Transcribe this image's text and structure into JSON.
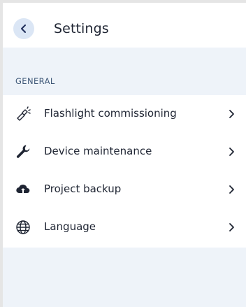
{
  "header": {
    "title": "Settings"
  },
  "general_section": {
    "label": "GENERAL",
    "items": [
      {
        "label": "Flashlight commissioning",
        "icon": "flashlight-icon"
      },
      {
        "label": "Device maintenance",
        "icon": "wrench-icon"
      },
      {
        "label": "Project backup",
        "icon": "cloud-upload-icon"
      },
      {
        "label": "Language",
        "icon": "globe-icon"
      }
    ]
  },
  "colors": {
    "background": "#eef3f9",
    "back_button_bg": "#dbe6f5",
    "accent": "#1f2d5a",
    "section_label": "#3f5878",
    "text": "#1f2533"
  }
}
